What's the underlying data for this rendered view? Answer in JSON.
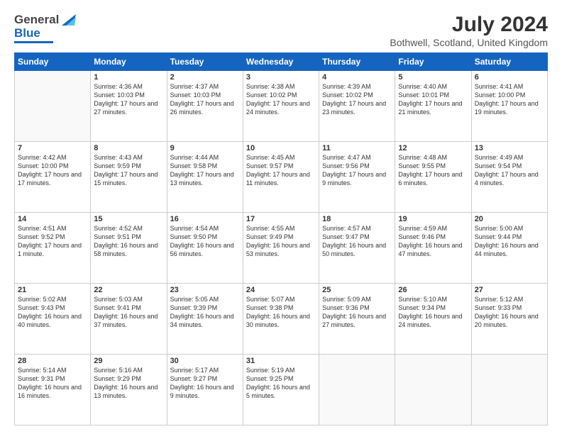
{
  "header": {
    "logo_general": "General",
    "logo_blue": "Blue",
    "month_title": "July 2024",
    "location": "Bothwell, Scotland, United Kingdom"
  },
  "days_of_week": [
    "Sunday",
    "Monday",
    "Tuesday",
    "Wednesday",
    "Thursday",
    "Friday",
    "Saturday"
  ],
  "weeks": [
    [
      {
        "day": "",
        "sunrise": "",
        "sunset": "",
        "daylight": ""
      },
      {
        "day": "1",
        "sunrise": "4:36 AM",
        "sunset": "10:03 PM",
        "daylight": "17 hours and 27 minutes."
      },
      {
        "day": "2",
        "sunrise": "4:37 AM",
        "sunset": "10:03 PM",
        "daylight": "17 hours and 26 minutes."
      },
      {
        "day": "3",
        "sunrise": "4:38 AM",
        "sunset": "10:02 PM",
        "daylight": "17 hours and 24 minutes."
      },
      {
        "day": "4",
        "sunrise": "4:39 AM",
        "sunset": "10:02 PM",
        "daylight": "17 hours and 23 minutes."
      },
      {
        "day": "5",
        "sunrise": "4:40 AM",
        "sunset": "10:01 PM",
        "daylight": "17 hours and 21 minutes."
      },
      {
        "day": "6",
        "sunrise": "4:41 AM",
        "sunset": "10:00 PM",
        "daylight": "17 hours and 19 minutes."
      }
    ],
    [
      {
        "day": "7",
        "sunrise": "4:42 AM",
        "sunset": "10:00 PM",
        "daylight": "17 hours and 17 minutes."
      },
      {
        "day": "8",
        "sunrise": "4:43 AM",
        "sunset": "9:59 PM",
        "daylight": "17 hours and 15 minutes."
      },
      {
        "day": "9",
        "sunrise": "4:44 AM",
        "sunset": "9:58 PM",
        "daylight": "17 hours and 13 minutes."
      },
      {
        "day": "10",
        "sunrise": "4:45 AM",
        "sunset": "9:57 PM",
        "daylight": "17 hours and 11 minutes."
      },
      {
        "day": "11",
        "sunrise": "4:47 AM",
        "sunset": "9:56 PM",
        "daylight": "17 hours and 9 minutes."
      },
      {
        "day": "12",
        "sunrise": "4:48 AM",
        "sunset": "9:55 PM",
        "daylight": "17 hours and 6 minutes."
      },
      {
        "day": "13",
        "sunrise": "4:49 AM",
        "sunset": "9:54 PM",
        "daylight": "17 hours and 4 minutes."
      }
    ],
    [
      {
        "day": "14",
        "sunrise": "4:51 AM",
        "sunset": "9:52 PM",
        "daylight": "17 hours and 1 minute."
      },
      {
        "day": "15",
        "sunrise": "4:52 AM",
        "sunset": "9:51 PM",
        "daylight": "16 hours and 58 minutes."
      },
      {
        "day": "16",
        "sunrise": "4:54 AM",
        "sunset": "9:50 PM",
        "daylight": "16 hours and 56 minutes."
      },
      {
        "day": "17",
        "sunrise": "4:55 AM",
        "sunset": "9:49 PM",
        "daylight": "16 hours and 53 minutes."
      },
      {
        "day": "18",
        "sunrise": "4:57 AM",
        "sunset": "9:47 PM",
        "daylight": "16 hours and 50 minutes."
      },
      {
        "day": "19",
        "sunrise": "4:59 AM",
        "sunset": "9:46 PM",
        "daylight": "16 hours and 47 minutes."
      },
      {
        "day": "20",
        "sunrise": "5:00 AM",
        "sunset": "9:44 PM",
        "daylight": "16 hours and 44 minutes."
      }
    ],
    [
      {
        "day": "21",
        "sunrise": "5:02 AM",
        "sunset": "9:43 PM",
        "daylight": "16 hours and 40 minutes."
      },
      {
        "day": "22",
        "sunrise": "5:03 AM",
        "sunset": "9:41 PM",
        "daylight": "16 hours and 37 minutes."
      },
      {
        "day": "23",
        "sunrise": "5:05 AM",
        "sunset": "9:39 PM",
        "daylight": "16 hours and 34 minutes."
      },
      {
        "day": "24",
        "sunrise": "5:07 AM",
        "sunset": "9:38 PM",
        "daylight": "16 hours and 30 minutes."
      },
      {
        "day": "25",
        "sunrise": "5:09 AM",
        "sunset": "9:36 PM",
        "daylight": "16 hours and 27 minutes."
      },
      {
        "day": "26",
        "sunrise": "5:10 AM",
        "sunset": "9:34 PM",
        "daylight": "16 hours and 24 minutes."
      },
      {
        "day": "27",
        "sunrise": "5:12 AM",
        "sunset": "9:33 PM",
        "daylight": "16 hours and 20 minutes."
      }
    ],
    [
      {
        "day": "28",
        "sunrise": "5:14 AM",
        "sunset": "9:31 PM",
        "daylight": "16 hours and 16 minutes."
      },
      {
        "day": "29",
        "sunrise": "5:16 AM",
        "sunset": "9:29 PM",
        "daylight": "16 hours and 13 minutes."
      },
      {
        "day": "30",
        "sunrise": "5:17 AM",
        "sunset": "9:27 PM",
        "daylight": "16 hours and 9 minutes."
      },
      {
        "day": "31",
        "sunrise": "5:19 AM",
        "sunset": "9:25 PM",
        "daylight": "16 hours and 5 minutes."
      },
      {
        "day": "",
        "sunrise": "",
        "sunset": "",
        "daylight": ""
      },
      {
        "day": "",
        "sunrise": "",
        "sunset": "",
        "daylight": ""
      },
      {
        "day": "",
        "sunrise": "",
        "sunset": "",
        "daylight": ""
      }
    ]
  ]
}
